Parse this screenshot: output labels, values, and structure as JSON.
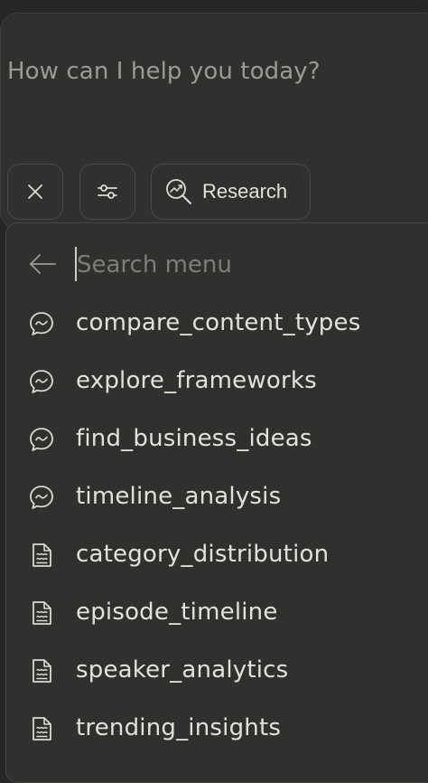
{
  "composer": {
    "placeholder": "How can I help you today?",
    "research_label": "Research"
  },
  "menu": {
    "search_placeholder": "Search menu",
    "items": [
      {
        "label": "compare_content_types",
        "icon": "chat-bubble-icon"
      },
      {
        "label": "explore_frameworks",
        "icon": "chat-bubble-icon"
      },
      {
        "label": "find_business_ideas",
        "icon": "chat-bubble-icon"
      },
      {
        "label": "timeline_analysis",
        "icon": "chat-bubble-icon"
      },
      {
        "label": "category_distribution",
        "icon": "document-icon"
      },
      {
        "label": "episode_timeline",
        "icon": "document-icon"
      },
      {
        "label": "speaker_analytics",
        "icon": "document-icon"
      },
      {
        "label": "trending_insights",
        "icon": "document-icon"
      }
    ]
  },
  "colors": {
    "background": "#262624",
    "panel": "#30302e",
    "text": "#e3e1d9",
    "muted": "#9c9a92"
  }
}
